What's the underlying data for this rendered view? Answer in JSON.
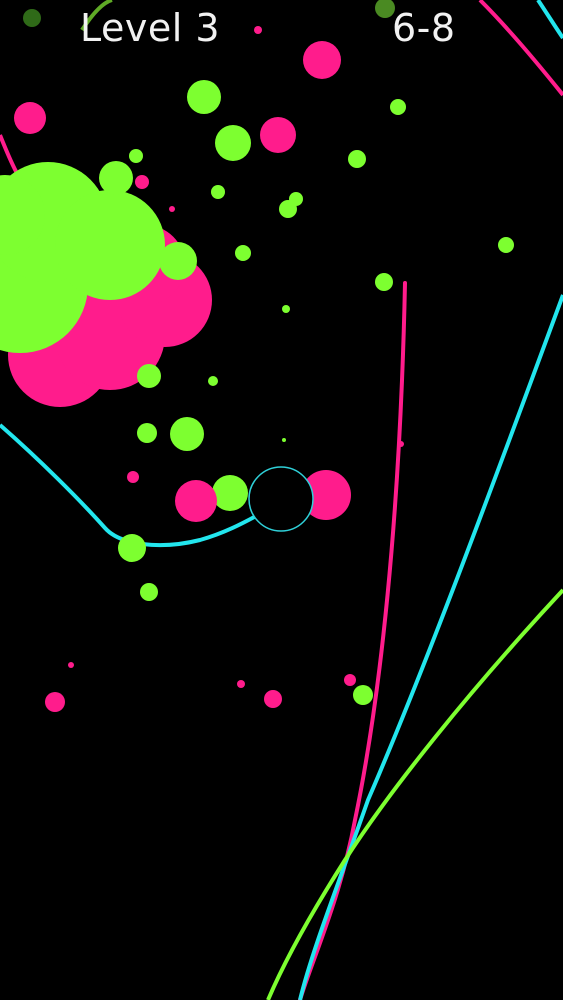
{
  "hud": {
    "level_label": "Level 3",
    "score_label": "6-8"
  },
  "colors": {
    "background": "#000000",
    "green": "#7dff30",
    "pink": "#ff1c8c",
    "cyan": "#22e6ee",
    "ring": "#2fd0d8"
  },
  "entities": {
    "player": "player-ring",
    "blobs": [
      "green-paint-splat",
      "pink-paint-splat"
    ],
    "lines": [
      "cyan-track",
      "pink-track",
      "green-track"
    ]
  }
}
